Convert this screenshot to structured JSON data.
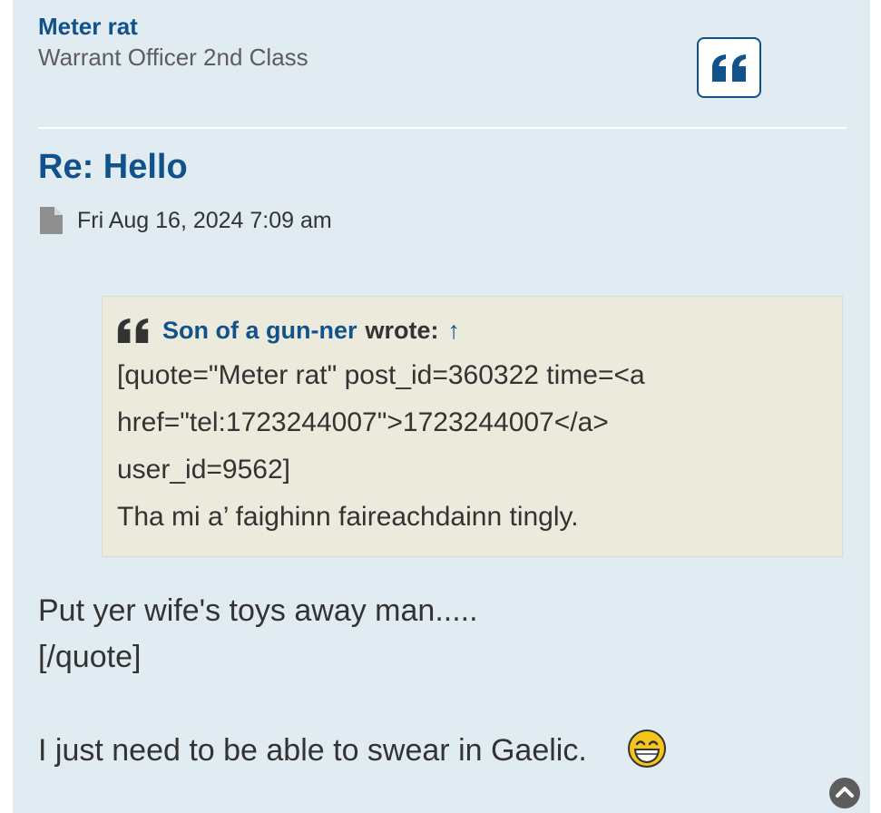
{
  "author": {
    "name": "Meter rat",
    "rank": "Warrant Officer 2nd Class"
  },
  "post": {
    "title": "Re: Hello",
    "date": "Fri Aug 16, 2024 7:09 am",
    "quote": {
      "username": "Son of a gun-ner",
      "wrote_label": "wrote:",
      "arrow": "↑",
      "lines": [
        "[quote=\"Meter rat\" post_id=360322 time=<a",
        "href=\"tel:1723244007\">1723244007</a>",
        "user_id=9562]",
        "Tha mi a’ faighinn faireachdainn tingly."
      ]
    },
    "body_lines": [
      "Put yer wife's toys away man.....",
      "[/quote]",
      "I just need to be able to swear in Gaelic."
    ]
  },
  "icons": {
    "quote_button": "quote-icon",
    "post_meta": "file-icon",
    "quote_cite": "quote-icon",
    "emoji": "grinning-face-icon",
    "scroll_top": "chevron-up-circle-icon"
  },
  "colors": {
    "panel_bg": "#e1ebf2",
    "link": "#105289",
    "text": "#333333",
    "rank_text": "#5d5d5d",
    "quote_bg": "#ebeadd",
    "meta_icon": "#8f8f8f"
  }
}
